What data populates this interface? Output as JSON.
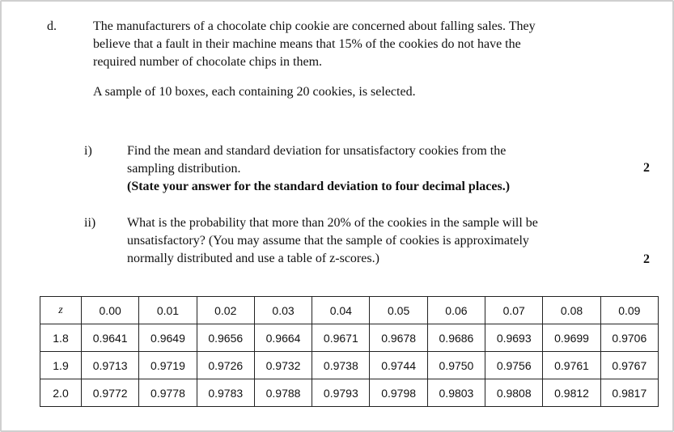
{
  "question": {
    "label": "d.",
    "intro_lines": [
      "The manufacturers of a chocolate chip cookie are concerned about falling sales. They",
      "believe that a fault in their machine means that 15% of the cookies do not have the",
      "required number of chocolate chips in them."
    ],
    "sample_line": "A sample of 10 boxes, each containing 20 cookies, is selected.",
    "part_i": {
      "label": "i)",
      "lines": [
        "Find the mean and standard deviation for unsatisfactory cookies from the",
        "sampling distribution."
      ],
      "bold_line": "(State your answer for the standard deviation to four decimal places.)",
      "marks": "2"
    },
    "part_ii": {
      "label": "ii)",
      "lines": [
        "What is the probability that more than 20% of the cookies in the sample will be",
        "unsatisfactory? (You may assume that the sample of cookies is approximately",
        "normally distributed and use a table of z-scores.)"
      ],
      "marks": "2"
    }
  },
  "z_table": {
    "header": [
      "z",
      "0.00",
      "0.01",
      "0.02",
      "0.03",
      "0.04",
      "0.05",
      "0.06",
      "0.07",
      "0.08",
      "0.09"
    ],
    "rows": [
      [
        "1.8",
        "0.9641",
        "0.9649",
        "0.9656",
        "0.9664",
        "0.9671",
        "0.9678",
        "0.9686",
        "0.9693",
        "0.9699",
        "0.9706"
      ],
      [
        "1.9",
        "0.9713",
        "0.9719",
        "0.9726",
        "0.9732",
        "0.9738",
        "0.9744",
        "0.9750",
        "0.9756",
        "0.9761",
        "0.9767"
      ],
      [
        "2.0",
        "0.9772",
        "0.9778",
        "0.9783",
        "0.9788",
        "0.9793",
        "0.9798",
        "0.9803",
        "0.9808",
        "0.9812",
        "0.9817"
      ]
    ]
  }
}
